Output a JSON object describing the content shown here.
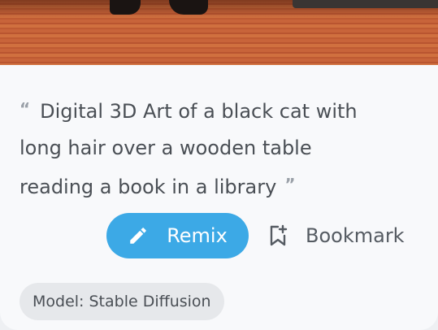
{
  "card": {
    "prompt_text_line1": "Digital 3D Art of a black cat with",
    "prompt_text_line2": "long hair over a wooden table",
    "prompt_text_line3": "reading a book in a library",
    "open_quote": "“",
    "close_quote": "”"
  },
  "actions": {
    "remix_label": "Remix",
    "remix_icon": "pencil-icon",
    "bookmark_label": "Bookmark",
    "bookmark_icon": "bookmark-add-icon"
  },
  "badge": {
    "model_label": "Model: Stable Diffusion"
  },
  "colors": {
    "accent": "#3ca9e6",
    "text": "#4a4f55",
    "muted": "#9aa0a8",
    "card_bg": "#f8f9fb",
    "badge_bg": "#e6e8eb"
  }
}
